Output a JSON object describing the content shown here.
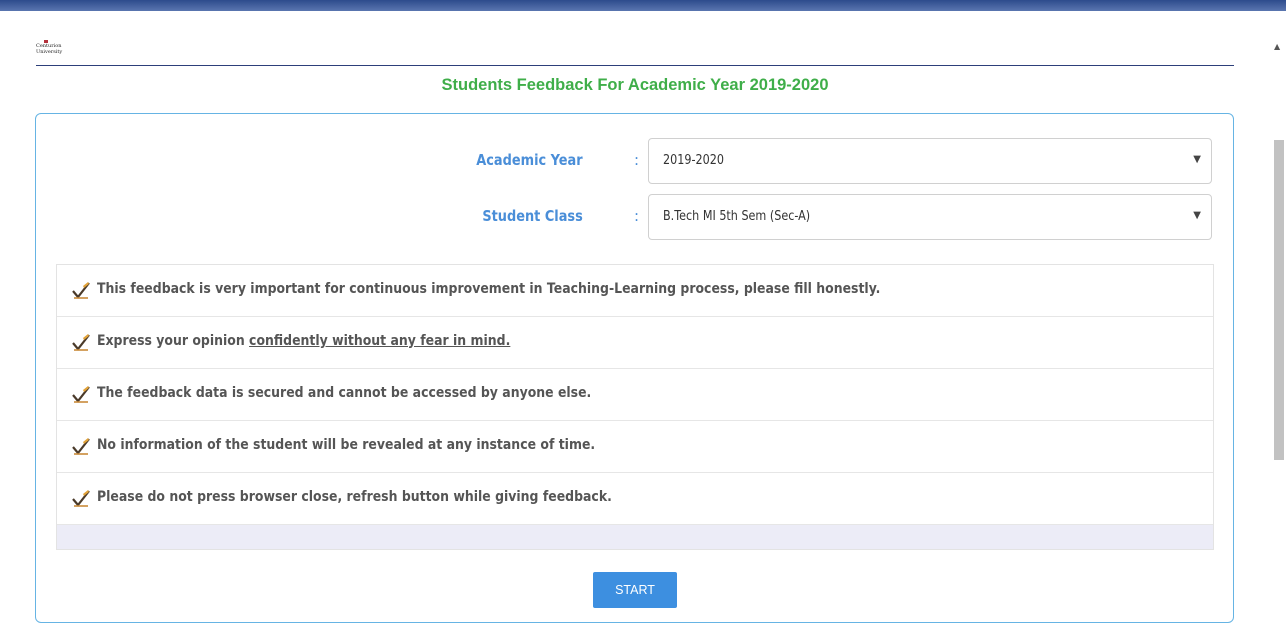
{
  "header": {
    "logo_line1": "Centurion",
    "logo_line2": "University"
  },
  "page_title": "Students Feedback For Academic Year 2019-2020",
  "form": {
    "academic_year_label": "Academic Year",
    "academic_year_value": "2019-2020",
    "student_class_label": "Student Class",
    "student_class_value": "B.Tech MI 5th Sem (Sec-A)",
    "colon": ":"
  },
  "notes": [
    "This feedback is very important for continuous improvement in Teaching-Learning process, please fill honestly.",
    "Express your opinion ",
    "The feedback data is secured and cannot be accessed by anyone else.",
    "No information of the student will be revealed at any instance of time.",
    "Please do not press browser close, refresh button while giving feedback."
  ],
  "note2_underlined": "confidently without any fear in mind.",
  "start_label": "START",
  "colors": {
    "title_green": "#3fae49",
    "label_blue": "#4a8ed8",
    "panel_border": "#66b4e4",
    "button_blue": "#3d8fe0"
  },
  "icons": {
    "note_icon": "checkmark-pencil-icon",
    "select_caret": "caret-down-icon"
  }
}
